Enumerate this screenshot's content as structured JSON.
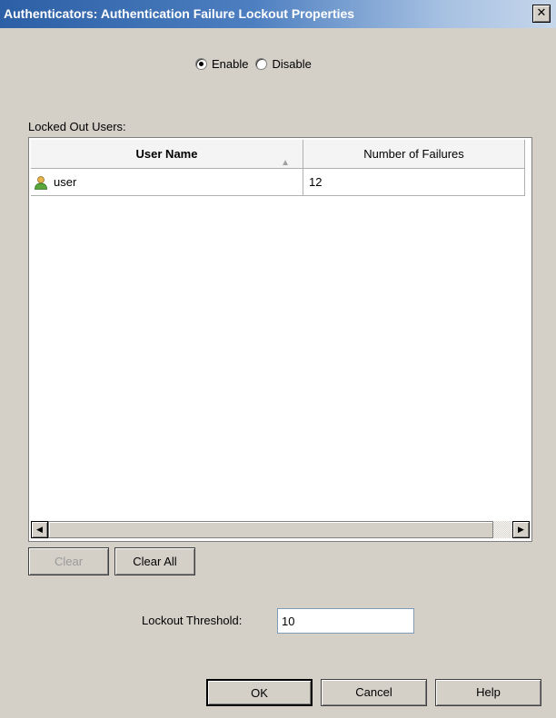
{
  "window": {
    "title": "Authenticators: Authentication Failure Lockout Properties",
    "close_glyph": "✕"
  },
  "mode": {
    "options": [
      {
        "label": "Enable",
        "checked": true
      },
      {
        "label": "Disable",
        "checked": false
      }
    ]
  },
  "locked_out": {
    "section_label": "Locked Out Users:",
    "columns": [
      "User Name",
      "Number of Failures"
    ],
    "sort_indicator": "▲",
    "rows": [
      {
        "user": "user",
        "failures": "12",
        "icon": "user-icon"
      }
    ]
  },
  "scrollbar": {
    "left_arrow": "◀",
    "right_arrow": "▶"
  },
  "actions": {
    "clear_label": "Clear",
    "clear_all_label": "Clear All"
  },
  "threshold": {
    "label": "Lockout Threshold:",
    "value": "10"
  },
  "footer": {
    "ok_label": "OK",
    "cancel_label": "Cancel",
    "help_label": "Help"
  },
  "colors": {
    "titlebar_start": "#2c5fa5",
    "titlebar_end": "#c6d6ea",
    "dialog_bg": "#d4d0c8",
    "disabled_text": "#9a9a9a"
  }
}
